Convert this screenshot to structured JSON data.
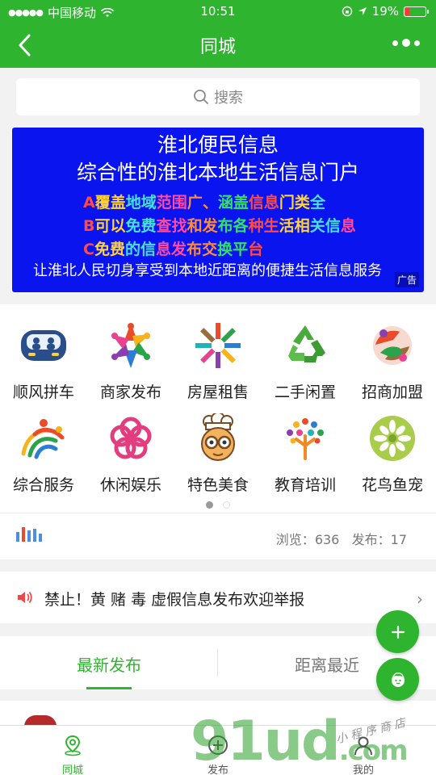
{
  "status_bar": {
    "carrier": "中国移动",
    "time": "10:51",
    "battery": "19%",
    "battery_level": 0.19
  },
  "navbar": {
    "title": "同城",
    "back_icon": "chevron-left-icon",
    "more_icon": "more-dots-icon"
  },
  "search": {
    "placeholder": "搜索",
    "icon": "search-icon"
  },
  "banner": {
    "title": "淮北便民信息",
    "subtitle": "综合性的淮北本地生活信息门户",
    "line_a": "A覆盖地域范围广、涵盖信息门类全",
    "line_b": "B可以免费查找和发布各种生活相关信息",
    "line_c": "C免费的信息发布交换平台",
    "line_d": "让淮北人民切身享受到本地近距离的便捷生活信息服务",
    "ad_label": "广告",
    "background": "#0a14ee"
  },
  "categories": [
    {
      "label": "顺风拼车",
      "icon": "car-icon"
    },
    {
      "label": "商家发布",
      "icon": "people-circle-icon"
    },
    {
      "label": "房屋租售",
      "icon": "houses-ring-icon"
    },
    {
      "label": "二手闲置",
      "icon": "recycle-icon"
    },
    {
      "label": "招商加盟",
      "icon": "handshake-icon"
    },
    {
      "label": "综合服务",
      "icon": "people-arc-icon"
    },
    {
      "label": "休闲娱乐",
      "icon": "flower-knot-icon"
    },
    {
      "label": "特色美食",
      "icon": "chef-icon"
    },
    {
      "label": "教育培训",
      "icon": "tree-people-icon"
    },
    {
      "label": "花鸟鱼宠",
      "icon": "leaf-flower-icon"
    }
  ],
  "pager": {
    "total": 2,
    "current": 1
  },
  "stats": {
    "views_label": "浏览：",
    "views": "636",
    "posts_label": "发布：",
    "posts": "17",
    "icon": "bar-chart-icon"
  },
  "notice": {
    "text": "禁止！黄 赌 毒 虚假信息发布欢迎举报",
    "icon": "speaker-icon"
  },
  "tabs": [
    {
      "label": "最新发布",
      "active": true
    },
    {
      "label": "距离最近",
      "active": false
    }
  ],
  "fabs": {
    "add_icon": "plus-icon",
    "profile_icon": "user-face-icon"
  },
  "tabbar": [
    {
      "label": "同城",
      "icon": "location-pin-icon",
      "active": true
    },
    {
      "label": "发布",
      "icon": "plus-circle-icon",
      "active": false
    },
    {
      "label": "我的",
      "icon": "user-icon",
      "active": false
    }
  ],
  "watermark": {
    "brand": "91ud",
    "suffix": ".com",
    "tagline": "小 程 序 商 店"
  },
  "colors": {
    "primary": "#2fb42f",
    "banner_red": "#ff4a4a"
  }
}
